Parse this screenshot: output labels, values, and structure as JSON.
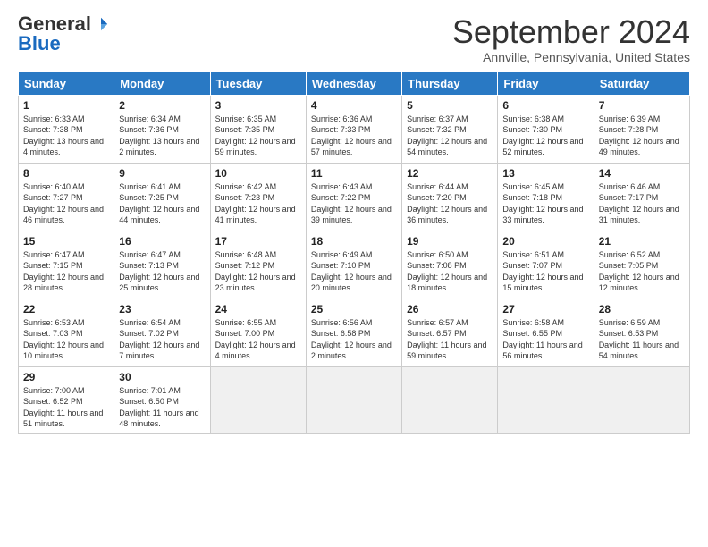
{
  "logo": {
    "general": "General",
    "blue": "Blue"
  },
  "header": {
    "month": "September 2024",
    "location": "Annville, Pennsylvania, United States"
  },
  "weekdays": [
    "Sunday",
    "Monday",
    "Tuesday",
    "Wednesday",
    "Thursday",
    "Friday",
    "Saturday"
  ],
  "weeks": [
    [
      {
        "day": "1",
        "sunrise": "6:33 AM",
        "sunset": "7:38 PM",
        "daylight": "13 hours and 4 minutes."
      },
      {
        "day": "2",
        "sunrise": "6:34 AM",
        "sunset": "7:36 PM",
        "daylight": "13 hours and 2 minutes."
      },
      {
        "day": "3",
        "sunrise": "6:35 AM",
        "sunset": "7:35 PM",
        "daylight": "12 hours and 59 minutes."
      },
      {
        "day": "4",
        "sunrise": "6:36 AM",
        "sunset": "7:33 PM",
        "daylight": "12 hours and 57 minutes."
      },
      {
        "day": "5",
        "sunrise": "6:37 AM",
        "sunset": "7:32 PM",
        "daylight": "12 hours and 54 minutes."
      },
      {
        "day": "6",
        "sunrise": "6:38 AM",
        "sunset": "7:30 PM",
        "daylight": "12 hours and 52 minutes."
      },
      {
        "day": "7",
        "sunrise": "6:39 AM",
        "sunset": "7:28 PM",
        "daylight": "12 hours and 49 minutes."
      }
    ],
    [
      {
        "day": "8",
        "sunrise": "6:40 AM",
        "sunset": "7:27 PM",
        "daylight": "12 hours and 46 minutes."
      },
      {
        "day": "9",
        "sunrise": "6:41 AM",
        "sunset": "7:25 PM",
        "daylight": "12 hours and 44 minutes."
      },
      {
        "day": "10",
        "sunrise": "6:42 AM",
        "sunset": "7:23 PM",
        "daylight": "12 hours and 41 minutes."
      },
      {
        "day": "11",
        "sunrise": "6:43 AM",
        "sunset": "7:22 PM",
        "daylight": "12 hours and 39 minutes."
      },
      {
        "day": "12",
        "sunrise": "6:44 AM",
        "sunset": "7:20 PM",
        "daylight": "12 hours and 36 minutes."
      },
      {
        "day": "13",
        "sunrise": "6:45 AM",
        "sunset": "7:18 PM",
        "daylight": "12 hours and 33 minutes."
      },
      {
        "day": "14",
        "sunrise": "6:46 AM",
        "sunset": "7:17 PM",
        "daylight": "12 hours and 31 minutes."
      }
    ],
    [
      {
        "day": "15",
        "sunrise": "6:47 AM",
        "sunset": "7:15 PM",
        "daylight": "12 hours and 28 minutes."
      },
      {
        "day": "16",
        "sunrise": "6:47 AM",
        "sunset": "7:13 PM",
        "daylight": "12 hours and 25 minutes."
      },
      {
        "day": "17",
        "sunrise": "6:48 AM",
        "sunset": "7:12 PM",
        "daylight": "12 hours and 23 minutes."
      },
      {
        "day": "18",
        "sunrise": "6:49 AM",
        "sunset": "7:10 PM",
        "daylight": "12 hours and 20 minutes."
      },
      {
        "day": "19",
        "sunrise": "6:50 AM",
        "sunset": "7:08 PM",
        "daylight": "12 hours and 18 minutes."
      },
      {
        "day": "20",
        "sunrise": "6:51 AM",
        "sunset": "7:07 PM",
        "daylight": "12 hours and 15 minutes."
      },
      {
        "day": "21",
        "sunrise": "6:52 AM",
        "sunset": "7:05 PM",
        "daylight": "12 hours and 12 minutes."
      }
    ],
    [
      {
        "day": "22",
        "sunrise": "6:53 AM",
        "sunset": "7:03 PM",
        "daylight": "12 hours and 10 minutes."
      },
      {
        "day": "23",
        "sunrise": "6:54 AM",
        "sunset": "7:02 PM",
        "daylight": "12 hours and 7 minutes."
      },
      {
        "day": "24",
        "sunrise": "6:55 AM",
        "sunset": "7:00 PM",
        "daylight": "12 hours and 4 minutes."
      },
      {
        "day": "25",
        "sunrise": "6:56 AM",
        "sunset": "6:58 PM",
        "daylight": "12 hours and 2 minutes."
      },
      {
        "day": "26",
        "sunrise": "6:57 AM",
        "sunset": "6:57 PM",
        "daylight": "11 hours and 59 minutes."
      },
      {
        "day": "27",
        "sunrise": "6:58 AM",
        "sunset": "6:55 PM",
        "daylight": "11 hours and 56 minutes."
      },
      {
        "day": "28",
        "sunrise": "6:59 AM",
        "sunset": "6:53 PM",
        "daylight": "11 hours and 54 minutes."
      }
    ],
    [
      {
        "day": "29",
        "sunrise": "7:00 AM",
        "sunset": "6:52 PM",
        "daylight": "11 hours and 51 minutes."
      },
      {
        "day": "30",
        "sunrise": "7:01 AM",
        "sunset": "6:50 PM",
        "daylight": "11 hours and 48 minutes."
      },
      null,
      null,
      null,
      null,
      null
    ]
  ]
}
